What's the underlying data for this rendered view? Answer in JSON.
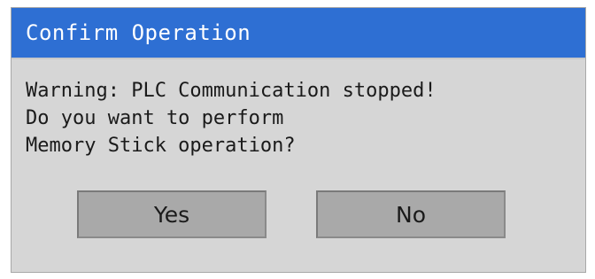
{
  "dialog": {
    "title": "Confirm Operation",
    "message_lines": [
      "Warning: PLC Communication stopped!",
      "Do you want to perform",
      "Memory Stick operation?"
    ],
    "buttons": {
      "yes_label": "Yes",
      "no_label": "No"
    }
  },
  "colors": {
    "titlebar": "#2e6fd3",
    "title_text": "#ffffff",
    "dialog_background": "#d6d6d6",
    "button_background": "#a9a9a9"
  }
}
